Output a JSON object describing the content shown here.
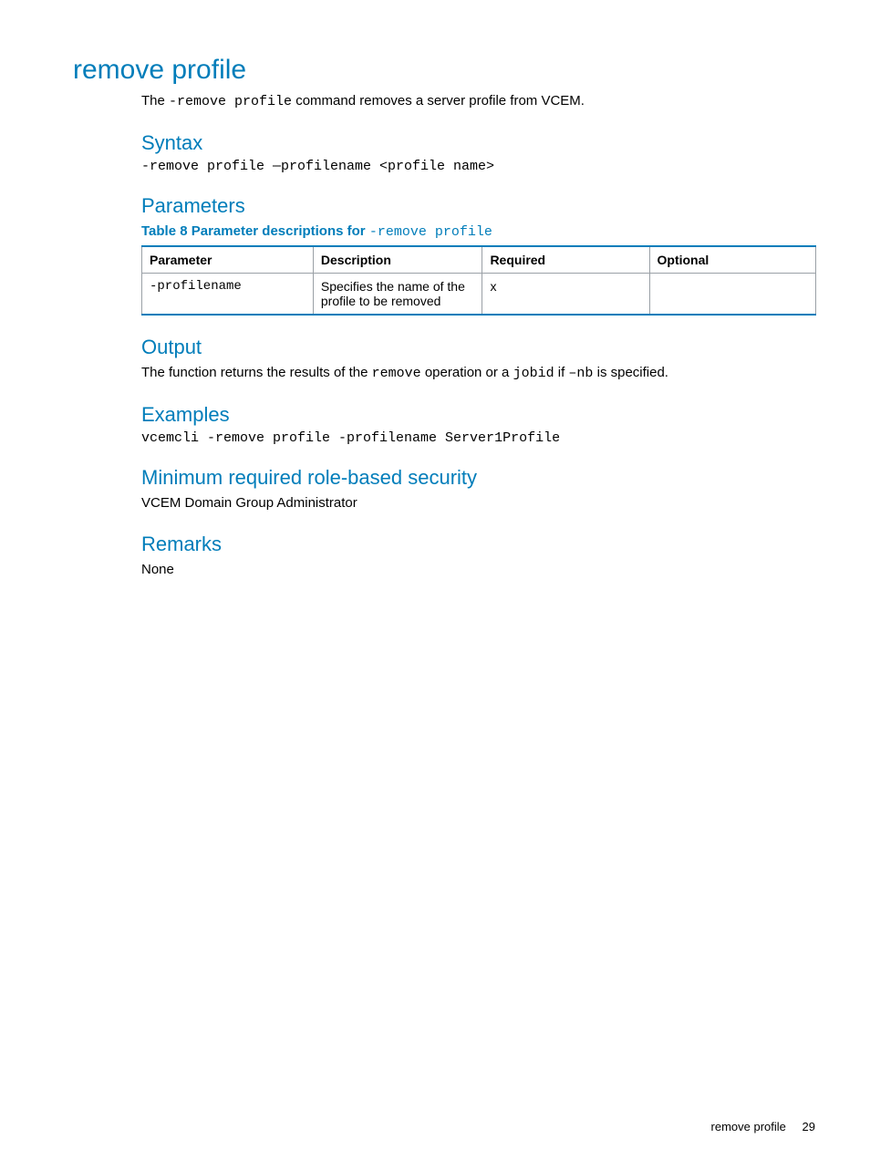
{
  "page": {
    "title": "remove profile",
    "intro": {
      "prefix": "The ",
      "command": "-remove profile",
      "suffix": " command removes a server profile from VCEM."
    }
  },
  "syntax": {
    "heading": "Syntax",
    "code": "-remove profile —profilename <profile name>"
  },
  "parameters": {
    "heading": "Parameters",
    "table_title_prefix": "Table 8 Parameter descriptions for ",
    "table_title_code": "-remove profile",
    "headers": [
      "Parameter",
      "Description",
      "Required",
      "Optional"
    ],
    "rows": [
      {
        "param": "-profilename",
        "desc": "Specifies the name of the profile to be removed",
        "required": "x",
        "optional": ""
      }
    ]
  },
  "output": {
    "heading": "Output",
    "text_prefix": "The function returns the results of the ",
    "code1": "remove",
    "text_mid1": " operation or a ",
    "code2": "jobid",
    "text_mid2": " if ",
    "code3": "–nb",
    "text_suffix": " is specified."
  },
  "examples": {
    "heading": "Examples",
    "code": "vcemcli -remove profile -profilename Server1Profile"
  },
  "security": {
    "heading": "Minimum required role-based security",
    "text": "VCEM Domain Group Administrator"
  },
  "remarks": {
    "heading": "Remarks",
    "text": "None"
  },
  "footer": {
    "label": "remove profile",
    "page_number": "29"
  }
}
